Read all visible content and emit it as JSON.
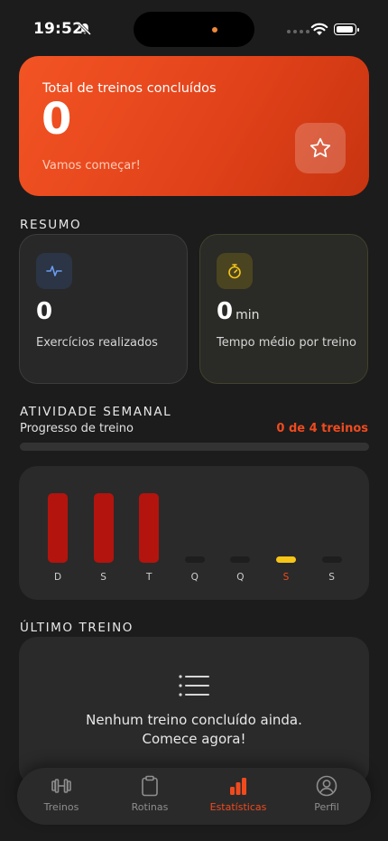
{
  "status_bar": {
    "time": "19:52"
  },
  "hero": {
    "label": "Total de treinos concluídos",
    "value": "0",
    "subtitle": "Vamos começar!",
    "icon": "star-icon"
  },
  "summary": {
    "title": "RESUMO",
    "exercises": {
      "value": "0",
      "label": "Exercícios realizados",
      "icon": "activity-pulse-icon"
    },
    "avg_time": {
      "value": "0",
      "unit": "min",
      "label": "Tempo médio por treino",
      "icon": "stopwatch-icon"
    }
  },
  "weekly": {
    "title": "ATIVIDADE SEMANAL",
    "progress_label": "Progresso de treino",
    "progress_count": "0 de 4 treinos",
    "progress_fraction": 0,
    "days": [
      {
        "label": "D",
        "state": "filled"
      },
      {
        "label": "S",
        "state": "filled"
      },
      {
        "label": "T",
        "state": "filled"
      },
      {
        "label": "Q",
        "state": "empty"
      },
      {
        "label": "Q",
        "state": "empty"
      },
      {
        "label": "S",
        "state": "today"
      },
      {
        "label": "S",
        "state": "empty"
      }
    ]
  },
  "last_workout": {
    "title": "ÚLTIMO TREINO",
    "empty_line1": "Nenhum treino concluído ainda.",
    "empty_line2": "Comece agora!",
    "icon": "list-icon"
  },
  "tabs": [
    {
      "label": "Treinos",
      "icon": "dumbbell-icon",
      "active": false
    },
    {
      "label": "Rotinas",
      "icon": "clipboard-icon",
      "active": false
    },
    {
      "label": "Estatísticas",
      "icon": "bar-chart-icon",
      "active": true
    },
    {
      "label": "Perfil",
      "icon": "user-circle-icon",
      "active": false
    }
  ],
  "colors": {
    "accent": "#f04a1e",
    "hero_gradient_start": "#f35424",
    "hero_gradient_end": "#c73410",
    "bar_filled": "#b3140e",
    "bar_today": "#f5c518",
    "bar_empty": "#1e1e1e",
    "background": "#1c1c1c"
  }
}
